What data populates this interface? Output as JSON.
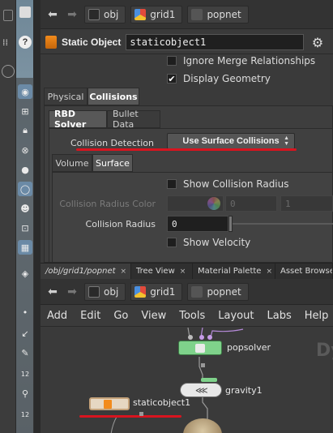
{
  "param_pane": {
    "path": {
      "back_icon": "back-arrow-icon",
      "forward_icon": "forward-arrow-icon",
      "crumbs": [
        "obj",
        "grid1",
        "popnet"
      ]
    },
    "node_type": "Static Object",
    "node_name": "staticobject1",
    "options": [
      {
        "label": "Ignore Merge Relationships",
        "checked": false
      },
      {
        "label": "Display Geometry",
        "checked": true
      }
    ],
    "tabs": [
      "Physical",
      "Collisions"
    ],
    "selected_tab": "Collisions",
    "sub_tabs": [
      "RBD Solver",
      "Bullet Data"
    ],
    "selected_sub_tab": "RBD Solver",
    "collision_detection": {
      "label": "Collision Detection",
      "value": "Use Surface Collisions"
    },
    "inner_tabs": [
      "Volume",
      "Surface"
    ],
    "selected_inner_tab": "Surface",
    "show_collision_radius": {
      "label": "Show Collision Radius",
      "checked": false
    },
    "collision_radius_color": {
      "label": "Collision Radius Color",
      "values": [
        "0",
        "1"
      ]
    },
    "collision_radius": {
      "label": "Collision Radius",
      "value": "0"
    },
    "show_velocity": {
      "label": "Show Velocity",
      "checked": false
    },
    "highlight_color": "#d8141f"
  },
  "pane_tabs": [
    {
      "label": "/obj/grid1/popnet",
      "selected": true
    },
    {
      "label": "Tree View",
      "selected": false
    },
    {
      "label": "Material Palette",
      "selected": false
    },
    {
      "label": "Asset Browser",
      "selected": false
    }
  ],
  "pane_tab_close": "×",
  "network": {
    "crumbs": [
      "obj",
      "grid1",
      "popnet"
    ],
    "menu": [
      "Add",
      "Edit",
      "Go",
      "View",
      "Tools",
      "Layout",
      "Labs",
      "Help"
    ],
    "nodes": [
      "popsolver",
      "gravity1",
      "staticobject1"
    ],
    "watermark": "Dy"
  },
  "viewport_icons": [
    "view-icon",
    "snap-icon",
    "lock-icon",
    "close-circle-icon",
    "sphere-icon",
    "light-icon",
    "skull-icon",
    "camera-icon",
    "grid-icon",
    "render-icon",
    "dot-icon",
    "arrow-icon",
    "pen-icon",
    "number-icon",
    "brush-icon",
    "number-icon"
  ],
  "viewport_numbers": [
    "12",
    "12"
  ]
}
